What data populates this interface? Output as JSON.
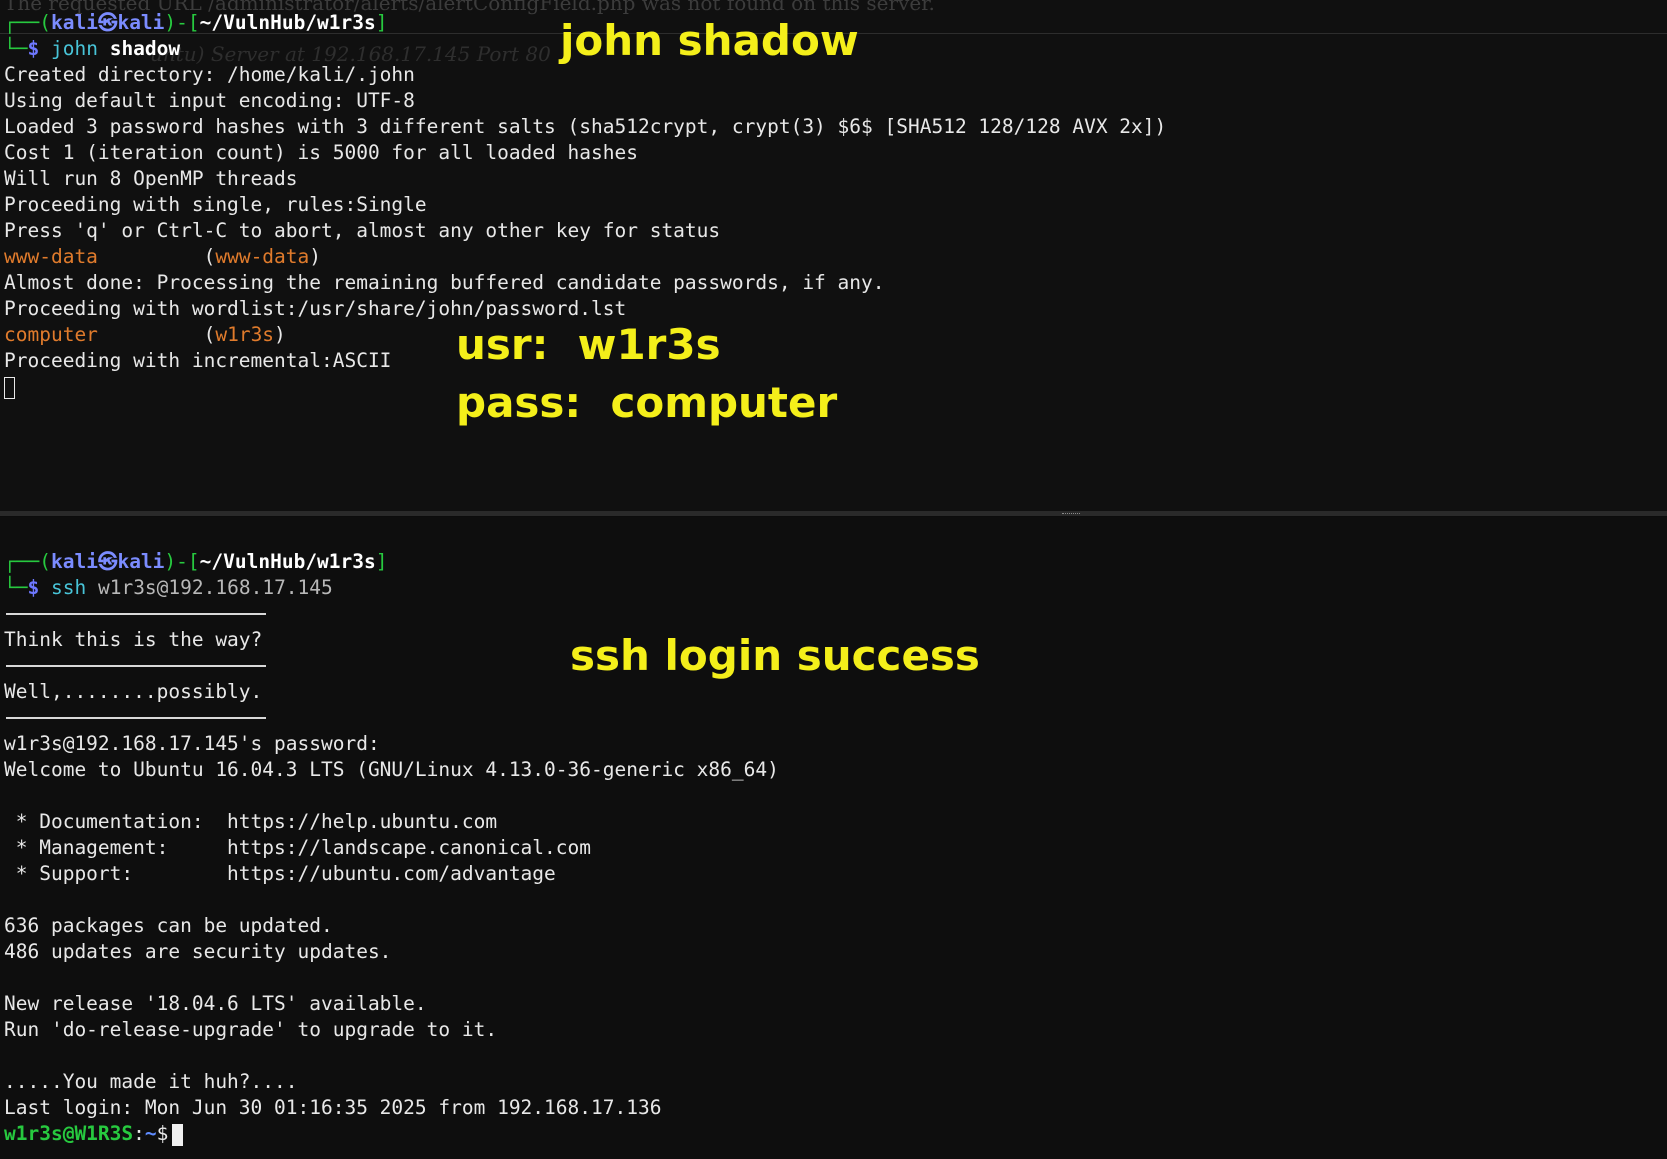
{
  "colors": {
    "annotation": "#f4ef1a",
    "terminal_bg": "#101010",
    "prompt_user": "#7b8cff",
    "command": "#48c4d8",
    "cracked": "#e07b2c",
    "shell_prompt": "#27c93f"
  },
  "top_pane": {
    "ghost_line_1": "The requested URL /administrator/alerts/alertConfigField.php was not found on this server.",
    "ghost_line_2": "untu) Server at 192.168.17.145 Port 80",
    "prompt": {
      "box_open": "┌──(",
      "user": "kali",
      "at_icon": "㉿",
      "host": "kali",
      "mid": ")-[",
      "path": "~/VulnHub/w1r3s",
      "close": "]",
      "box_corner": "└─",
      "dollar": "$"
    },
    "command": "john",
    "argument": "shadow",
    "output": [
      "Created directory: /home/kali/.john",
      "Using default input encoding: UTF-8",
      "Loaded 3 password hashes with 3 different salts (sha512crypt, crypt(3) $6$ [SHA512 128/128 AVX 2x])",
      "Cost 1 (iteration count) is 5000 for all loaded hashes",
      "Will run 8 OpenMP threads",
      "Proceeding with single, rules:Single",
      "Press 'q' or Ctrl-C to abort, almost any other key for status"
    ],
    "cracked_1": {
      "password": "www-data",
      "pad": "         ",
      "open": "(",
      "user": "www-data",
      "close": ")"
    },
    "after_crack_1": [
      "Almost done: Processing the remaining buffered candidate passwords, if any.",
      "Proceeding with wordlist:/usr/share/john/password.lst"
    ],
    "cracked_2": {
      "password": "computer",
      "pad": "         ",
      "open": "(",
      "user": "w1r3s",
      "close": ")"
    },
    "after_crack_2": "Proceeding with incremental:ASCII"
  },
  "annotations": {
    "john_shadow": "john shadow",
    "usr": "usr:  w1r3s",
    "pass": "pass:  computer",
    "ssh_success": "ssh login success"
  },
  "bottom_pane": {
    "prompt": {
      "box_open": "┌──(",
      "user": "kali",
      "at_icon": "㉿",
      "host": "kali",
      "mid": ")-[",
      "path": "~/VulnHub/w1r3s",
      "close": "]",
      "box_corner": "└─",
      "dollar": "$"
    },
    "command": "ssh",
    "argument": "w1r3s@192.168.17.145",
    "banner_1": "Think this is the way?",
    "banner_2": "Well,........possibly.",
    "password_prompt": "w1r3s@192.168.17.145's password:",
    "welcome": "Welcome to Ubuntu 16.04.3 LTS (GNU/Linux 4.13.0-36-generic x86_64)",
    "links": [
      " * Documentation:  https://help.ubuntu.com",
      " * Management:     https://landscape.canonical.com",
      " * Support:        https://ubuntu.com/advantage"
    ],
    "packages": "636 packages can be updated.",
    "security": "486 updates are security updates.",
    "new_release": "New release '18.04.6 LTS' available.",
    "upgrade_hint": "Run 'do-release-upgrade' to upgrade to it.",
    "made_it": ".....You made it huh?....",
    "last_login": "Last login: Mon Jun 30 01:16:35 2025 from 192.168.17.136",
    "shell_prompt": {
      "user_host": "w1r3s@W1R3S",
      "colon": ":",
      "path": "~",
      "dollar": "$"
    }
  }
}
